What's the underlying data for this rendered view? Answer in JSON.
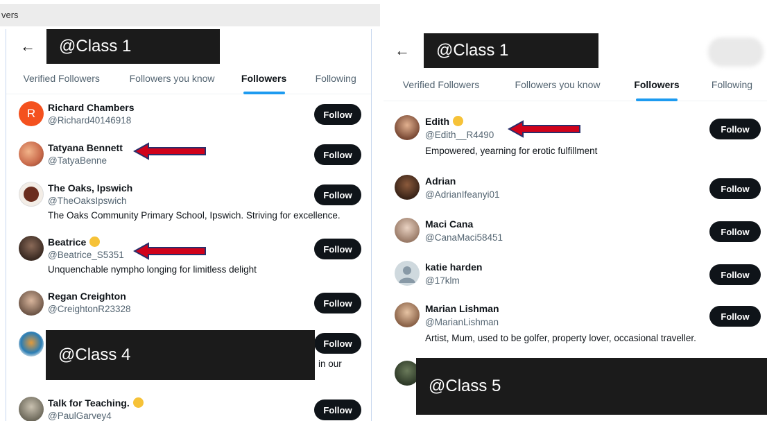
{
  "url_fragment": "vers",
  "left": {
    "title_label": "@Class 1",
    "tabs": [
      "Verified Followers",
      "Followers you know",
      "Followers",
      "Following"
    ],
    "rows": [
      {
        "name": "Richard Chambers",
        "handle": "@Richard40146918",
        "bio": "",
        "avatar_letter": "R"
      },
      {
        "name": "Tatyana Bennett",
        "handle": "@TatyaBenne",
        "bio": ""
      },
      {
        "name": "The Oaks, Ipswich",
        "handle": "@TheOaksIpswich",
        "bio": "The Oaks Community Primary School, Ipswich. Striving for excellence."
      },
      {
        "name": "Beatrice",
        "handle": "@Beatrice_S5351",
        "bio": "Unquenchable nympho longing for limitless delight"
      },
      {
        "name": "Regan Creighton",
        "handle": "@CreightonR23328",
        "bio": ""
      },
      {
        "name": "Talk for Teaching.",
        "handle": "@PaulGarvey4",
        "bio": ""
      }
    ],
    "partial_text": "in our",
    "overlay_label": "@Class 4",
    "follow_label": "Follow"
  },
  "right": {
    "title_label": "@Class 1",
    "tabs": [
      "Verified Followers",
      "Followers you know",
      "Followers",
      "Following"
    ],
    "rows": [
      {
        "name": "Edith",
        "handle": "@Edith__R4490",
        "bio": "Empowered, yearning for erotic fulfillment"
      },
      {
        "name": "Adrian",
        "handle": "@AdrianIfeanyi01",
        "bio": ""
      },
      {
        "name": "Maci Cana",
        "handle": "@CanaMaci58451",
        "bio": ""
      },
      {
        "name": "katie harden",
        "handle": "@17klm",
        "bio": ""
      },
      {
        "name": "Marian Lishman",
        "handle": "@MarianLishman",
        "bio": "Artist, Mum, used to be golfer, property lover, occasional traveller."
      }
    ],
    "overlay_label": "@Class 5",
    "follow_label": "Follow"
  },
  "colors": {
    "accent": "#1d9bf0",
    "button": "#0f1419",
    "arrow": "#d0021b",
    "redaction": "#1b1b1b"
  }
}
